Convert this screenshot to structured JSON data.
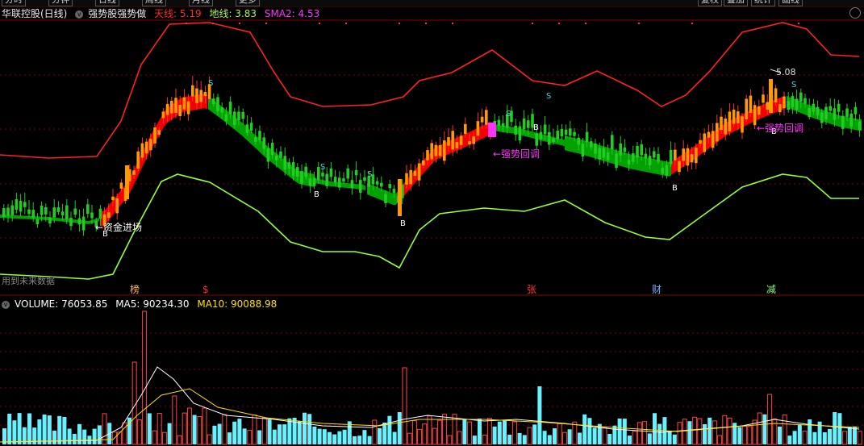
{
  "toolbar": {
    "buttons": [
      {
        "label": "分时"
      },
      {
        "label": "分钟"
      },
      {
        "label": "日线"
      },
      {
        "label": "周线"
      },
      {
        "label": "月线"
      },
      {
        "label": "更多"
      }
    ],
    "right_buttons": [
      {
        "label": "复权"
      },
      {
        "label": "叠加"
      },
      {
        "label": "统计"
      },
      {
        "label": "画线"
      }
    ]
  },
  "main_panel": {
    "stock_name": "华联控股(日线)",
    "indicator_name": "强势股强势做",
    "upper_label": "天线: 5.19",
    "lower_label": "地线: 3.83",
    "sma_label": "SMA2: 4.53",
    "label_colors": {
      "upper": "#ff2b2b",
      "lower": "#aef04a",
      "sma": "#ff33ff"
    },
    "notice": "用到未来数据"
  },
  "volume_panel": {
    "volume_label": "VOLUME: 76053.85",
    "ma5_label": "MA5: 90234.30",
    "ma10_label": "MA10: 90088.98",
    "colors": {
      "volume": "#ffffff",
      "ma5": "#ffffff",
      "ma10": "#ffe000"
    }
  },
  "annotations": {
    "fund_entry": "←资金进场",
    "pullback": "←强势回调",
    "peak_price": "5.08",
    "buy": "B",
    "sell": "S"
  },
  "event_markers": [
    {
      "label": "榜",
      "color": "#ffb060"
    },
    {
      "label": "$",
      "color": "#ff3333"
    },
    {
      "label": "张",
      "color": "#ff3333"
    },
    {
      "label": "财",
      "color": "#6fb0ff"
    },
    {
      "label": "减",
      "color": "#7fff7f"
    }
  ],
  "theme_colors": {
    "background": "#000000",
    "up_candle": "#ff9900",
    "down_candle": "#22cc22",
    "strong_band": "#ff0000",
    "weak_band": "#00aa00",
    "upper_line": "#ff2222",
    "lower_line": "#99ff33",
    "volume_up": "#ff4444",
    "volume_down": "#66f2ff",
    "grid": "#7a0000"
  }
}
